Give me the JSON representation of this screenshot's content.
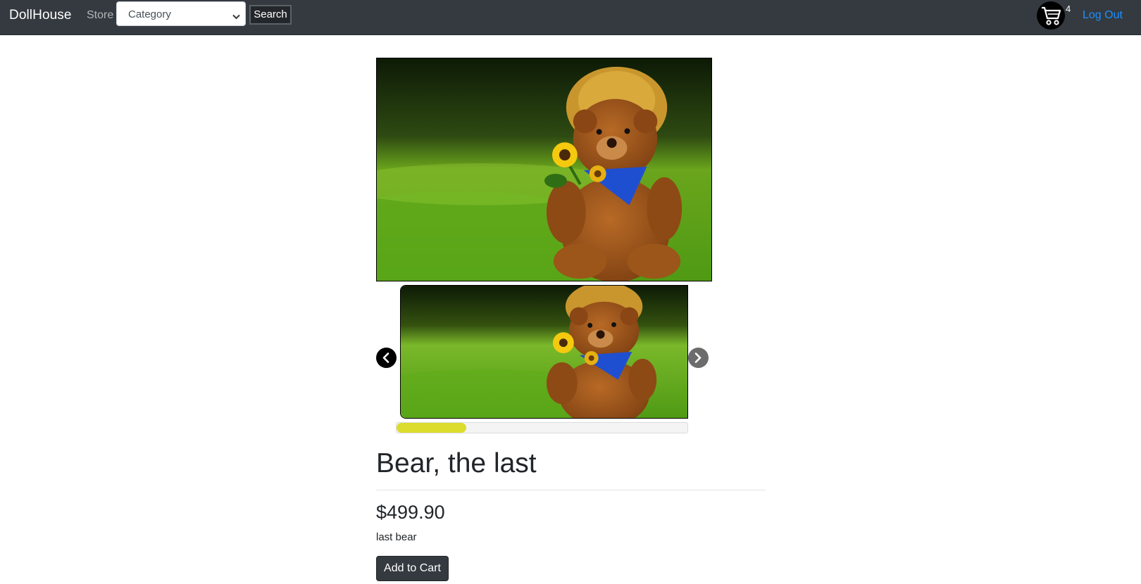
{
  "navbar": {
    "brand": "DollHouse",
    "store_link": "Store",
    "category_select": {
      "selected": "Category"
    },
    "search_button": "Search",
    "cart_count": "4",
    "logout_link": "Log Out"
  },
  "product": {
    "title": "Bear, the last",
    "price": "$499.90",
    "description": "last bear",
    "add_to_cart_label": "Add to Cart",
    "gallery_progress": 0.24
  },
  "colors": {
    "navbar_bg": "#343a40",
    "link": "#1e90ff",
    "progress_fill": "#dcdc2e"
  },
  "icons": [
    "cart-icon",
    "chevron-down-icon",
    "chevron-left-icon",
    "chevron-right-icon"
  ]
}
